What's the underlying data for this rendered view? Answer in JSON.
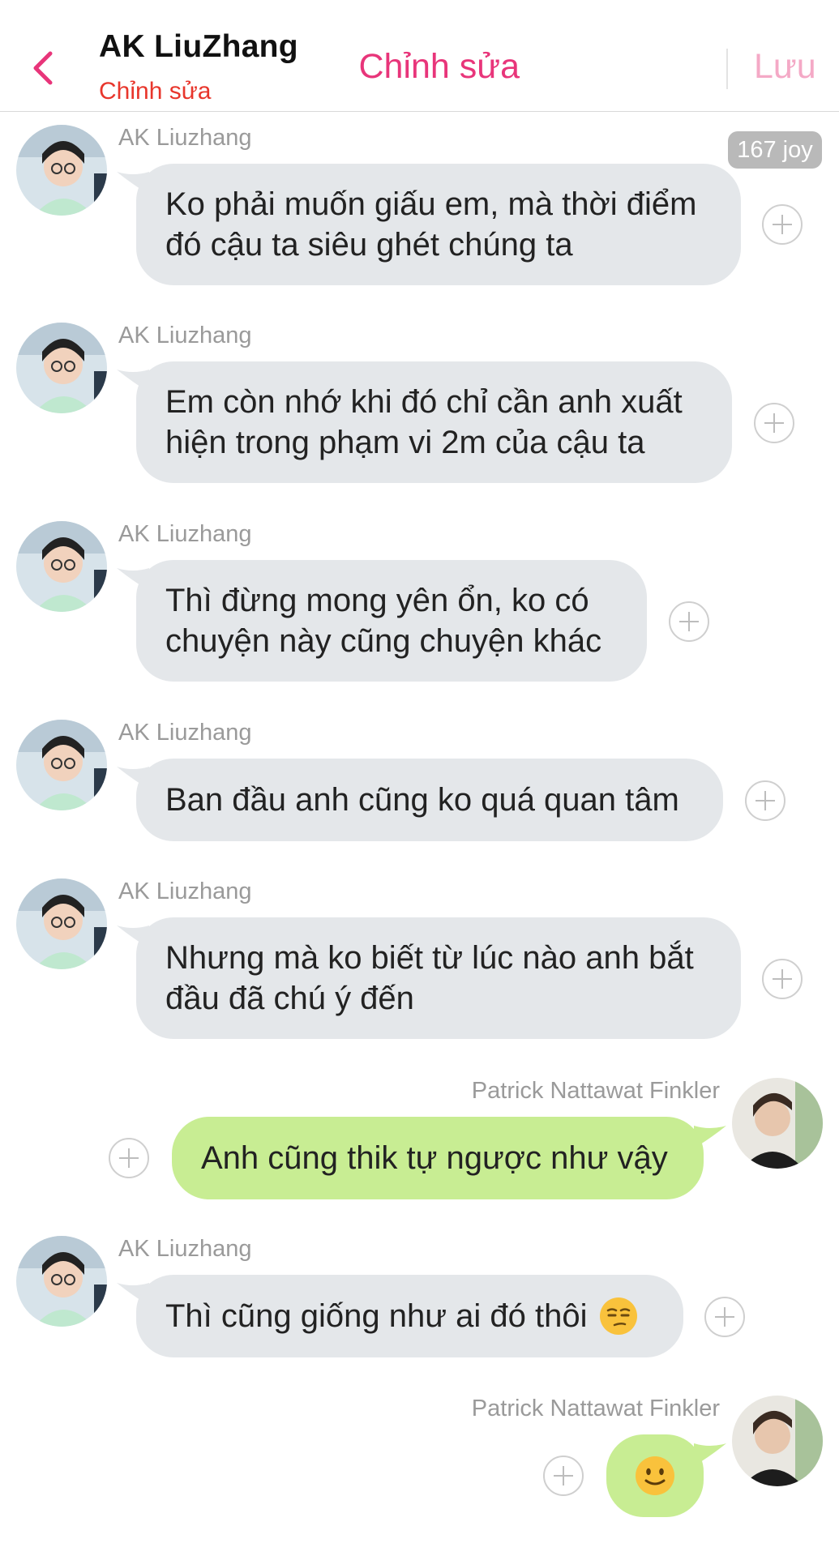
{
  "header": {
    "title": "AK LiuZhang",
    "subtitle": "Chỉnh sửa",
    "edit_label": "Chỉnh sửa",
    "save_label": "Lưu"
  },
  "joy_badge": "167 joy",
  "colors": {
    "accent": "#e8357a",
    "subtitle_red": "#e8362c",
    "incoming_bubble": "#e4e7ea",
    "outgoing_bubble": "#c8ed93"
  },
  "messages": [
    {
      "sender": "AK Liuzhang",
      "lines": [
        "Ko phải muốn giấu em, mà thời điểm",
        "đó cậu ta siêu ghét chúng ta"
      ]
    },
    {
      "sender": "AK Liuzhang",
      "lines": [
        "Em còn nhớ khi đó chỉ cần anh xuất",
        "hiện trong phạm vi 2m của cậu ta"
      ]
    },
    {
      "sender": "AK Liuzhang",
      "lines": [
        "Thì đừng mong yên ổn, ko có",
        "chuyện này cũng chuyện khác"
      ]
    },
    {
      "sender": "AK Liuzhang",
      "lines": [
        "Ban đầu anh cũng ko quá quan tâm"
      ]
    },
    {
      "sender": "AK Liuzhang",
      "lines": [
        "Nhưng mà ko biết từ lúc nào anh bắt",
        "đầu đã chú ý đến"
      ]
    },
    {
      "sender": "Patrick Nattawat Finkler",
      "lines": [
        "Anh cũng thik tự ngược như vậy"
      ]
    },
    {
      "sender": "AK Liuzhang",
      "lines": [
        "Thì cũng giống như ai đó thôi"
      ],
      "emoji": "unamused-face"
    },
    {
      "sender": "Patrick Nattawat Finkler",
      "emoji": "slightly-smiling-face"
    }
  ]
}
